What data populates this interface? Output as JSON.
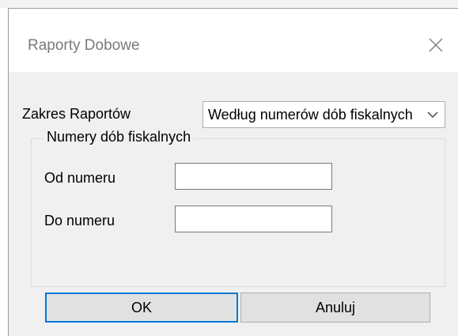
{
  "window": {
    "title": "Raporty Dobowe",
    "close_icon": "close-icon"
  },
  "range": {
    "label": "Zakres Raportów",
    "selected": "Według numerów dób fiskalnych",
    "arrow_icon": "chevron-down-icon"
  },
  "group": {
    "legend": "Numery dób fiskalnych",
    "from_label": "Od numeru",
    "from_value": "",
    "to_label": "Do numeru",
    "to_value": ""
  },
  "buttons": {
    "ok": "OK",
    "cancel": "Anuluj"
  },
  "colors": {
    "dialog_bg": "#f0f0f0",
    "button_bg": "#e1e1e1",
    "focus_accent": "#0078d7"
  }
}
